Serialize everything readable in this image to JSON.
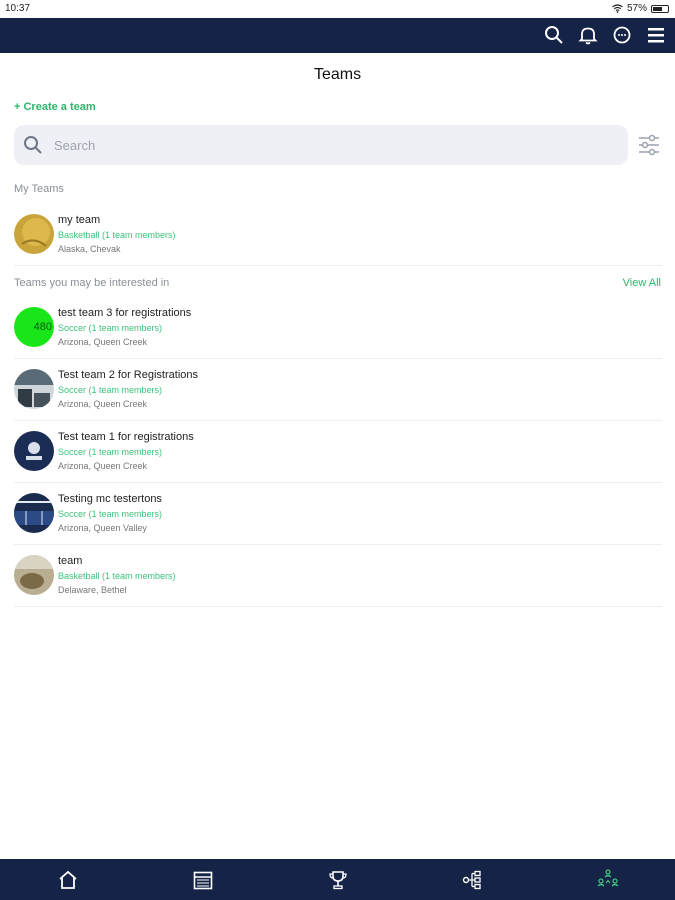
{
  "status": {
    "time": "10:37",
    "battery": "57%"
  },
  "page": {
    "title": "Teams"
  },
  "actions": {
    "create_team": "+ Create a team",
    "view_all": "View All"
  },
  "search": {
    "placeholder": "Search",
    "value": ""
  },
  "sections": {
    "my_teams": "My Teams",
    "interested": "Teams you may be interested in"
  },
  "my_teams": [
    {
      "name": "my team",
      "sport": "Basketball (1 team members)",
      "location": "Alaska, Chevak",
      "avatar_color": "#c9a43a"
    }
  ],
  "interested_teams": [
    {
      "name": "test team 3 for registrations",
      "sport": "Soccer (1 team members)",
      "location": "Arizona, Queen Creek",
      "avatar_color": "#19e619",
      "avatar_text": "480"
    },
    {
      "name": "Test team 2 for Registrations",
      "sport": "Soccer (1 team members)",
      "location": "Arizona, Queen Creek",
      "avatar_color": "#3d4a55"
    },
    {
      "name": "Test team 1 for registrations",
      "sport": "Soccer (1 team members)",
      "location": "Arizona, Queen Creek",
      "avatar_color": "#1c2d55"
    },
    {
      "name": "Testing mc testertons",
      "sport": "Soccer (1 team members)",
      "location": "Arizona, Queen Valley",
      "avatar_color": "#1b2b4e"
    },
    {
      "name": "team",
      "sport": "Basketball (1 team members)",
      "location": "Delaware, Bethel",
      "avatar_color": "#8a7b5c"
    }
  ],
  "colors": {
    "nav_bg": "#152347",
    "accent": "#2fb56b",
    "search_bg": "#eef0f5"
  },
  "nav": [
    "home-icon",
    "calendar-icon",
    "trophy-icon",
    "bracket-icon",
    "teams-icon"
  ]
}
